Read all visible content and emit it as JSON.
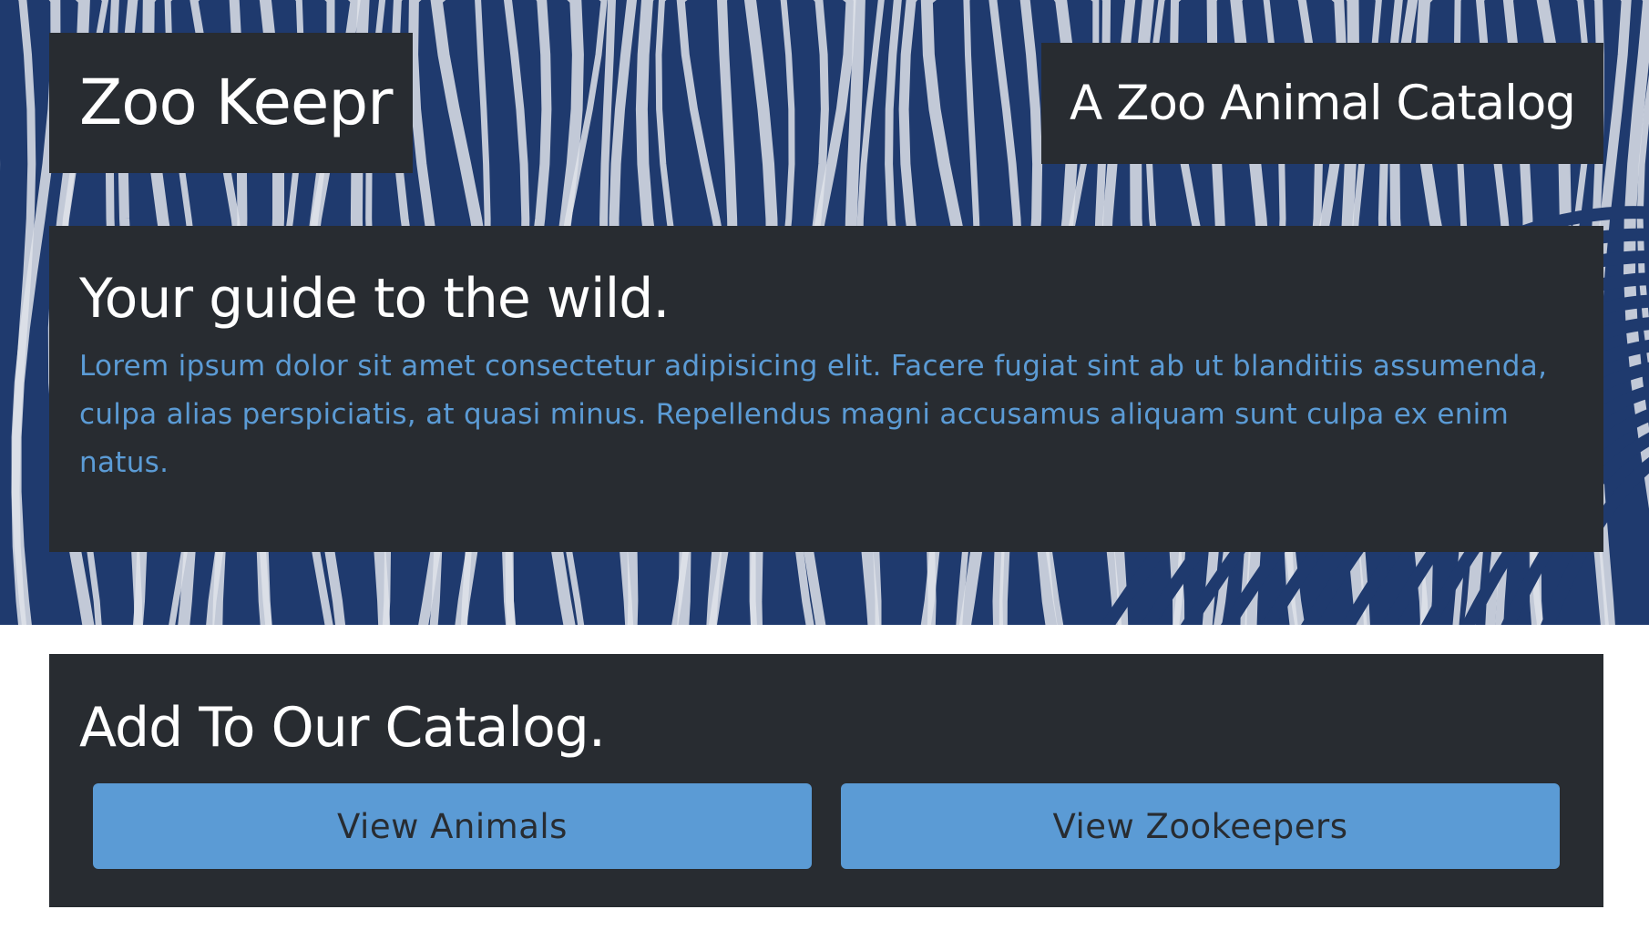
{
  "header": {
    "brand": "Zoo Keepr",
    "tagline": "A Zoo Animal Catalog"
  },
  "hero": {
    "background_image": "zebra-stripes",
    "heading": "Your guide to the wild.",
    "body": "Lorem ipsum dolor sit amet consectetur adipisicing elit. Facere fugiat sint ab ut blanditiis assumenda, culpa alias perspiciatis, at quasi minus. Repellendus magni accusamus aliquam sunt culpa ex enim natus."
  },
  "catalog": {
    "heading": "Add To Our Catalog.",
    "buttons": [
      {
        "label": "View Animals"
      },
      {
        "label": "View Zookeepers"
      }
    ]
  },
  "colors": {
    "panel": "#282c31",
    "accent": "#5b9bd5",
    "text_light": "#ffffff",
    "zebra_dark": "#1f3a6e",
    "zebra_light": "#dfe3ea"
  }
}
